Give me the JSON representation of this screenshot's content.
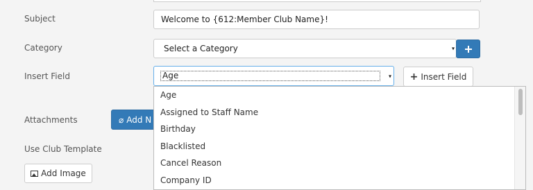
{
  "form": {
    "subject_label": "Subject",
    "subject_value": "Welcome to {612:Member Club Name}!",
    "category_label": "Category",
    "category_value": "Select a Category",
    "insert_field_label": "Insert Field",
    "insert_field_value": "Age",
    "insert_field_button": "Insert Field",
    "attachments_label": "Attachments",
    "attachments_button": "Add N",
    "use_club_template_label": "Use Club Template",
    "add_image_button": "Add Image"
  },
  "dropdown": {
    "options": [
      "Age",
      "Assigned to Staff Name",
      "Birthday",
      "Blacklisted",
      "Cancel Reason",
      "Company ID"
    ]
  },
  "colors": {
    "primary": "#337ab7",
    "focus_border": "#66afe9"
  }
}
